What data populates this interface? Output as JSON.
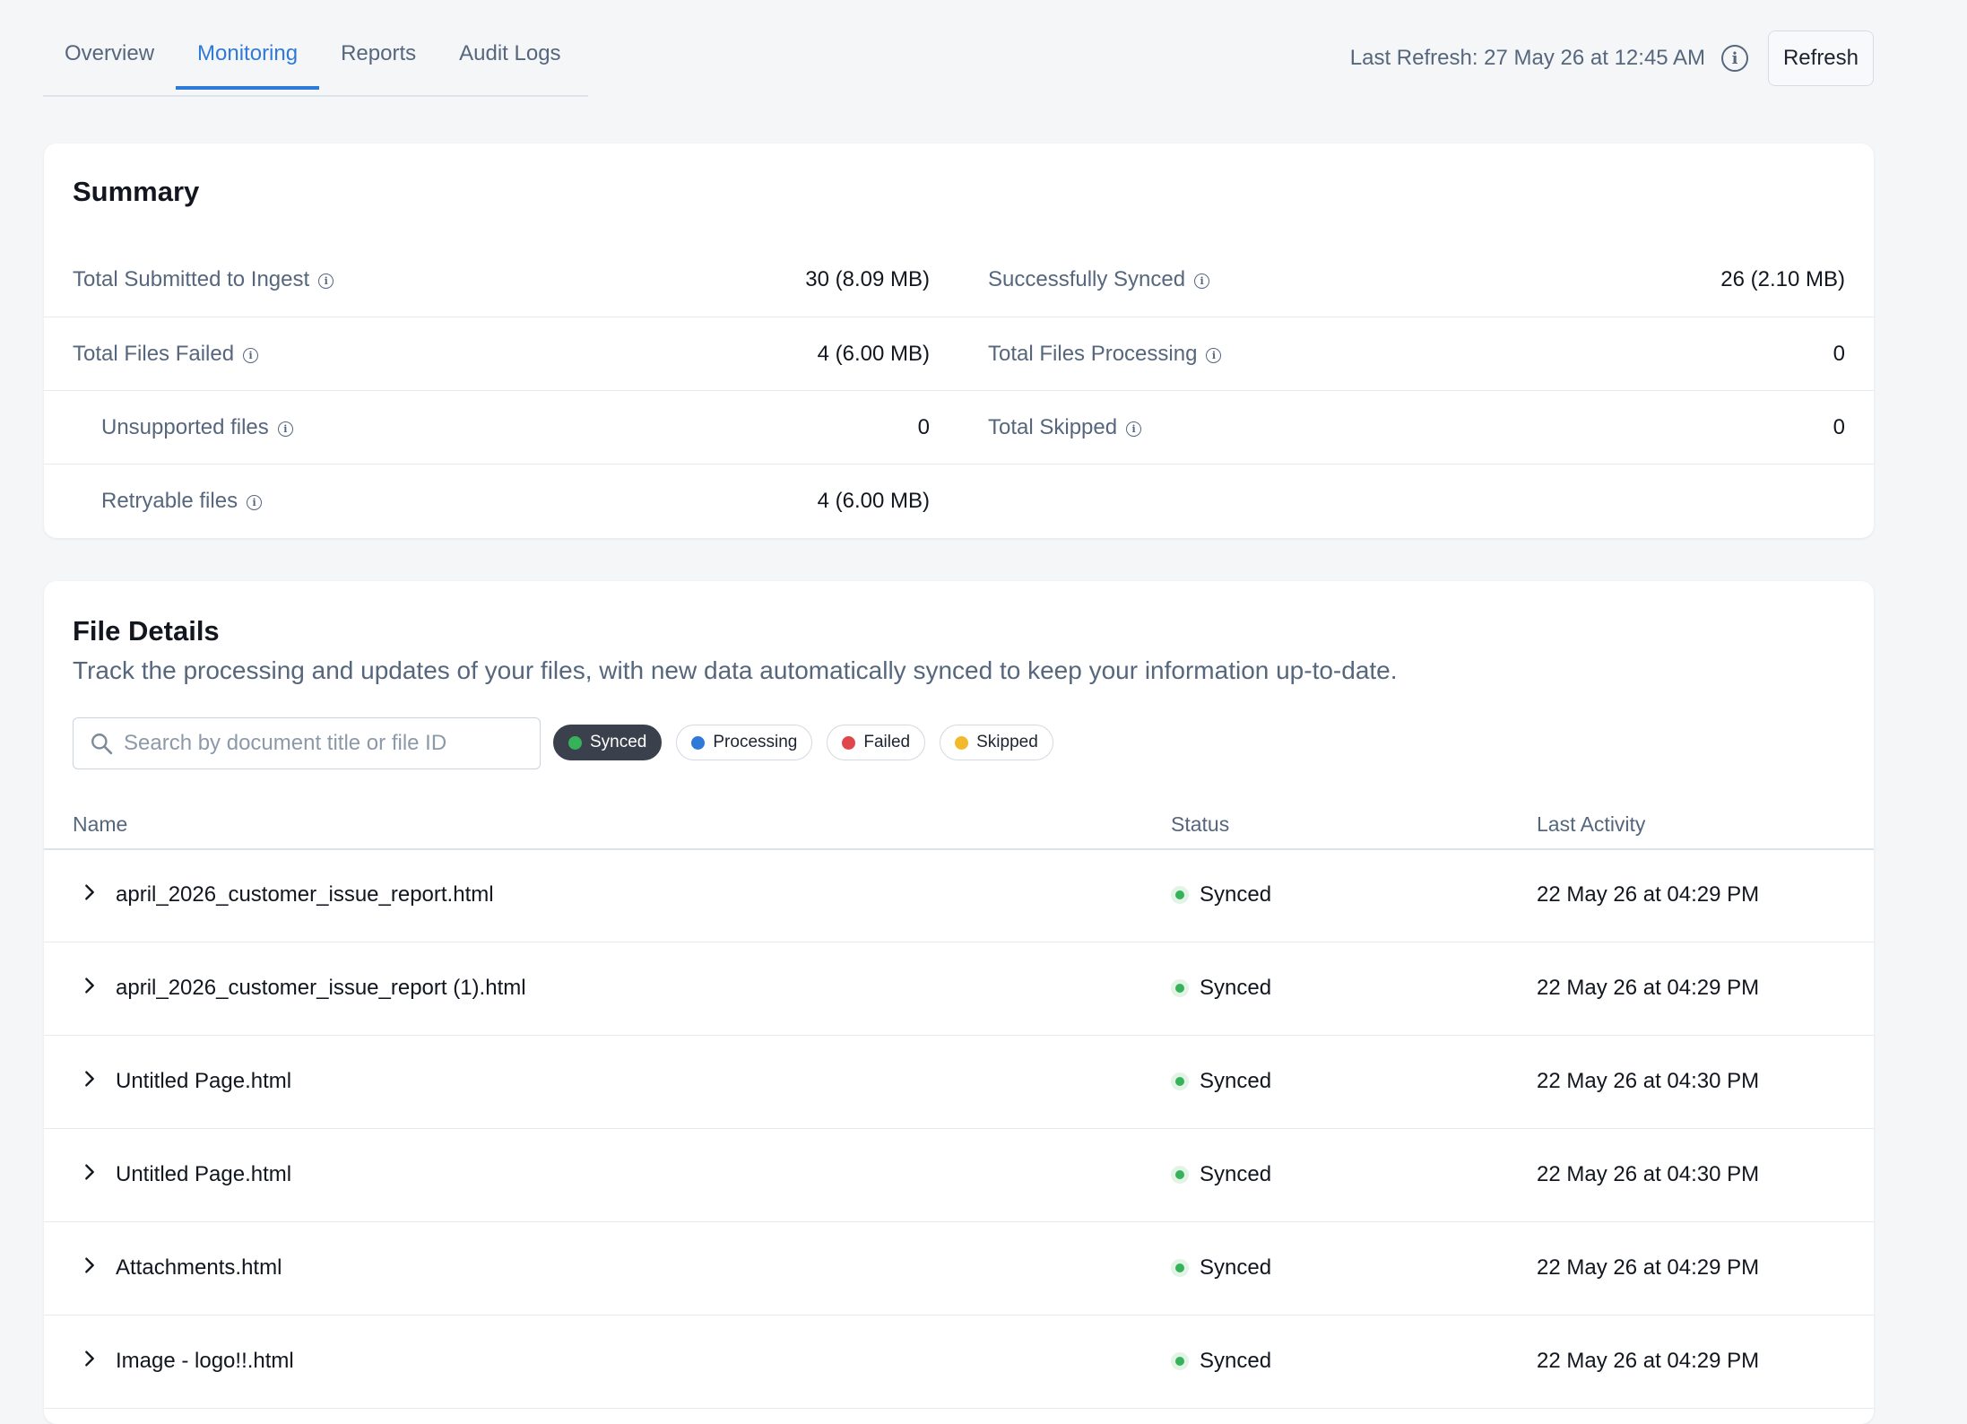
{
  "tabs": [
    "Overview",
    "Monitoring",
    "Reports",
    "Audit Logs"
  ],
  "active_tab": "Monitoring",
  "header": {
    "last_refresh": "Last Refresh: 27 May 26 at 12:45 AM",
    "refresh_label": "Refresh"
  },
  "summary": {
    "title": "Summary",
    "rows": [
      {
        "left_label": "Total Submitted to Ingest",
        "left_value": "30 (8.09 MB)",
        "right_label": "Successfully Synced",
        "right_value": "26 (2.10 MB)"
      },
      {
        "left_label": "Total Files Failed",
        "left_value": "4 (6.00 MB)",
        "right_label": "Total Files Processing",
        "right_value": "0"
      },
      {
        "left_label": "Unsupported files",
        "left_value": "0",
        "right_label": "Total Skipped",
        "right_value": "0"
      },
      {
        "left_label": "Retryable files",
        "left_value": "4 (6.00 MB)"
      }
    ]
  },
  "files": {
    "title": "File Details",
    "description": "Track the processing and updates of your files, with new data automatically synced to keep your information up-to-date.",
    "search_placeholder": "Search by document title or file ID",
    "filters": [
      {
        "label": "Synced",
        "color": "#35b25a",
        "active": true
      },
      {
        "label": "Processing",
        "color": "#2f79d9",
        "active": false
      },
      {
        "label": "Failed",
        "color": "#e0474c",
        "active": false
      },
      {
        "label": "Skipped",
        "color": "#f2b92b",
        "active": false
      }
    ],
    "columns": [
      "Name",
      "Status",
      "Last Activity"
    ],
    "rows": [
      {
        "name": "april_2026_customer_issue_report.html",
        "status": "Synced",
        "last_activity": "22 May 26 at 04:29 PM"
      },
      {
        "name": "april_2026_customer_issue_report (1).html",
        "status": "Synced",
        "last_activity": "22 May 26 at 04:29 PM"
      },
      {
        "name": "Untitled Page.html",
        "status": "Synced",
        "last_activity": "22 May 26 at 04:30 PM"
      },
      {
        "name": "Untitled Page.html",
        "status": "Synced",
        "last_activity": "22 May 26 at 04:30 PM"
      },
      {
        "name": "Attachments.html",
        "status": "Synced",
        "last_activity": "22 May 26 at 04:29 PM"
      },
      {
        "name": "Image - logo!!.html",
        "status": "Synced",
        "last_activity": "22 May 26 at 04:29 PM"
      }
    ]
  }
}
